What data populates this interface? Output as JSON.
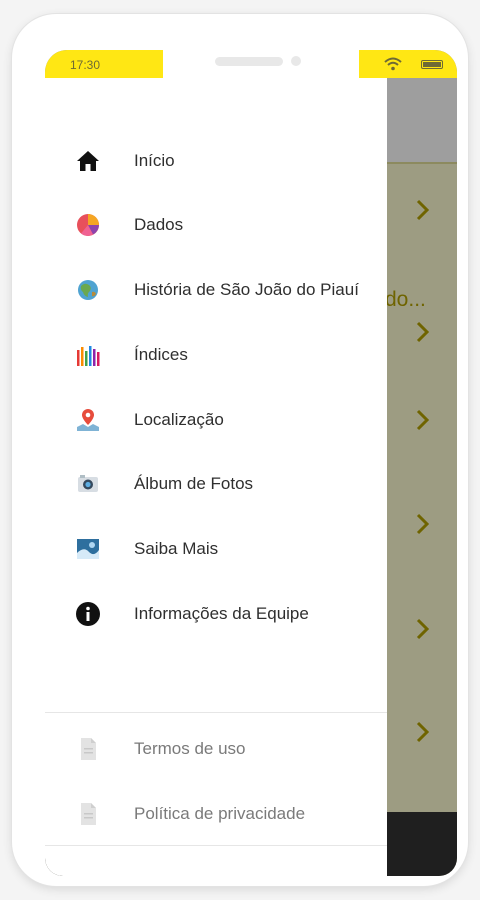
{
  "status_bar": {
    "time": "17:30"
  },
  "background_page": {
    "clipped_text": "do..."
  },
  "drawer": {
    "items": [
      {
        "label": "Início",
        "icon": "home-icon"
      },
      {
        "label": "Dados",
        "icon": "pie-chart-icon"
      },
      {
        "label": "História de São João do Piauí",
        "icon": "globe-icon"
      },
      {
        "label": "Índices",
        "icon": "bar-index-icon"
      },
      {
        "label": "Localização",
        "icon": "map-pin-icon"
      },
      {
        "label": "Álbum de Fotos",
        "icon": "camera-icon"
      },
      {
        "label": "Saiba Mais",
        "icon": "picture-icon"
      },
      {
        "label": "Informações da Equipe",
        "icon": "info-icon"
      }
    ],
    "footer_items": [
      {
        "label": "Termos de uso",
        "icon": "document-icon"
      },
      {
        "label": "Política de privacidade",
        "icon": "document-icon"
      }
    ]
  },
  "colors": {
    "status_bar": "#ffe714",
    "accent_dark": "#6f6400",
    "overlay": "#9d9c82"
  }
}
